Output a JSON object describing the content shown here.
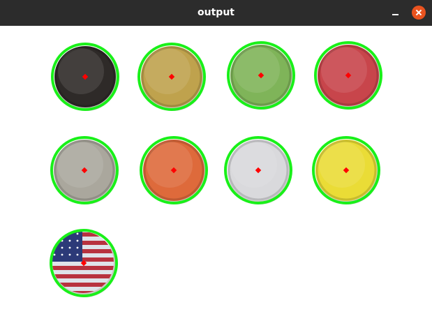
{
  "window": {
    "title": "output",
    "minimize_icon": "minimize-icon",
    "close_icon": "close-icon"
  },
  "caps": [
    {
      "kind": "dark",
      "color": "#2e2a28"
    },
    {
      "kind": "gold",
      "color": "#bfa24d"
    },
    {
      "kind": "green",
      "color": "#7fb459"
    },
    {
      "kind": "red",
      "color": "#c8454b"
    },
    {
      "kind": "silver",
      "color": "#aaa79d"
    },
    {
      "kind": "orange",
      "color": "#de6a3b"
    },
    {
      "kind": "white",
      "color": "#d9d9dc"
    },
    {
      "kind": "yellow",
      "color": "#eadc36"
    },
    {
      "kind": "flag",
      "color": "#8ea6c8"
    }
  ],
  "colors": {
    "titlebar": "#2c2c2c",
    "close_button": "#e9531f",
    "detection_circle": "#19f019",
    "center_marker": "#ff0000",
    "background": "#ffffff"
  }
}
